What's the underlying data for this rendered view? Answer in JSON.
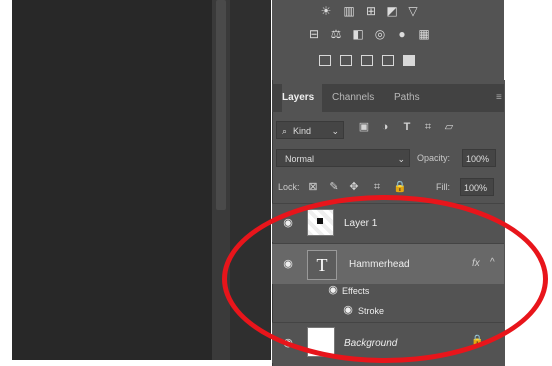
{
  "panel_tabs": {
    "layers": "Layers",
    "channels": "Channels",
    "paths": "Paths"
  },
  "filter": {
    "kind_label": "Kind"
  },
  "blend": {
    "mode": "Normal",
    "opacity_label": "Opacity:",
    "opacity_value": "100%"
  },
  "lock": {
    "label": "Lock:",
    "fill_label": "Fill:",
    "fill_value": "100%"
  },
  "layers": [
    {
      "name": "Layer 1"
    },
    {
      "name": "Hammerhead",
      "fx": "fx",
      "effects_label": "Effects",
      "stroke_label": "Stroke"
    },
    {
      "name": "Background"
    }
  ],
  "colors": {
    "annotation": "#e8151b",
    "panel": "#535353",
    "selected_row": "#686868"
  },
  "icons": [
    "eye-icon",
    "lock-icon",
    "type-layer-icon",
    "search-icon",
    "chevron-down-icon"
  ]
}
